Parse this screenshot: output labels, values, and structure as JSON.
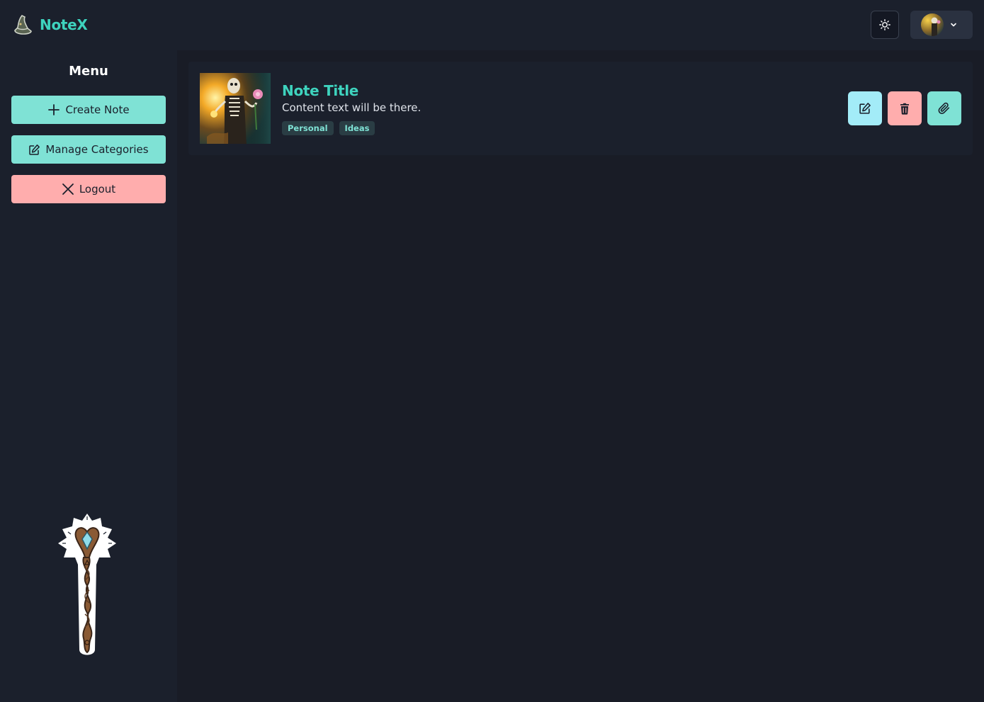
{
  "header": {
    "brand_name": "NoteX",
    "brand_logo_icon": "witch-hat-icon",
    "theme_toggle_icon": "sun-icon",
    "user_menu_icon": "chevron-down-icon"
  },
  "sidebar": {
    "title": "Menu",
    "buttons": [
      {
        "label": "Create Note",
        "icon": "plus-icon",
        "color": "#7fe2d5"
      },
      {
        "label": "Manage Categories",
        "icon": "edit-icon",
        "color": "#7fe2d5"
      },
      {
        "label": "Logout",
        "icon": "close-icon",
        "color": "#ffadad"
      }
    ],
    "illustration": "magic-staff"
  },
  "notes": [
    {
      "title": "Note Title",
      "content": "Content text will be there.",
      "tags": [
        "Personal",
        "Ideas"
      ],
      "thumbnail": "skeleton-with-flower",
      "actions": [
        {
          "name": "edit",
          "icon": "edit-icon",
          "color": "#a3ecf8"
        },
        {
          "name": "delete",
          "icon": "trash-icon",
          "color": "#ffadad"
        },
        {
          "name": "attach",
          "icon": "paperclip-icon",
          "color": "#7fe2d5"
        }
      ]
    }
  ],
  "colors": {
    "accent": "#3ed3be",
    "background": "#191c26",
    "panel": "#1b202c"
  }
}
